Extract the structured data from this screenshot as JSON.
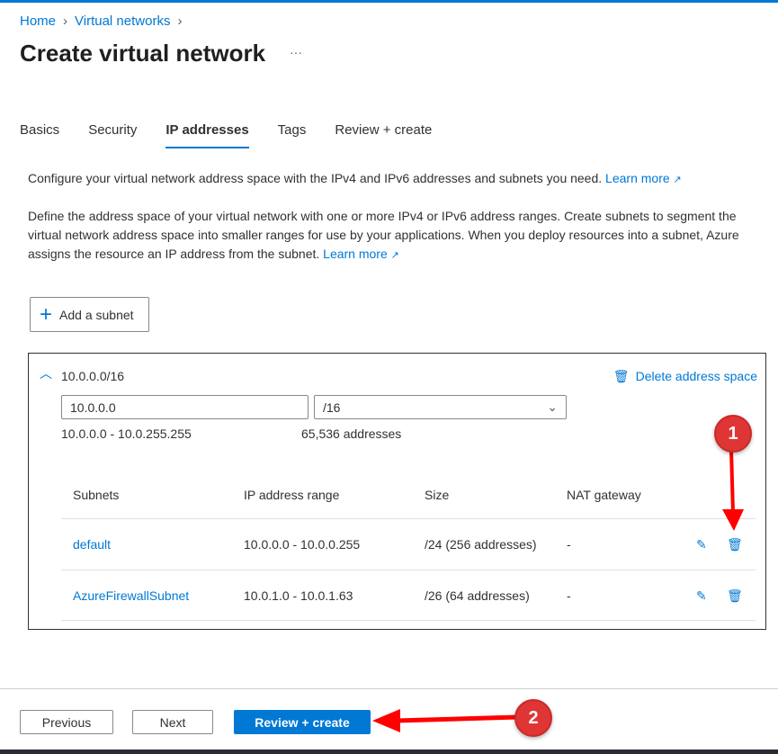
{
  "breadcrumb": [
    "Home",
    "Virtual networks"
  ],
  "title": "Create virtual network",
  "more": "···",
  "tabs": [
    "Basics",
    "Security",
    "IP addresses",
    "Tags",
    "Review + create"
  ],
  "intro": "Configure your virtual network address space with the IPv4 and IPv6 addresses and subnets you need.",
  "intro_link": "Learn more",
  "desc": "Define the address space of your virtual network with one or more IPv4 or IPv6 address ranges. Create subnets to segment the virtual network address space into smaller ranges for use by your applications. When you deploy resources into a subnet, Azure assigns the resource an IP address from the subnet.",
  "desc_link": "Learn more",
  "add_subnet": "Add a subnet",
  "address_space": {
    "title": "10.0.0.0/16",
    "delete": "Delete address space",
    "ip": "10.0.0.0",
    "prefix": "/16",
    "range": "10.0.0.0 - 10.0.255.255",
    "count": "65,536 addresses"
  },
  "table": {
    "headers": [
      "Subnets",
      "IP address range",
      "Size",
      "NAT gateway"
    ],
    "rows": [
      [
        "default",
        "10.0.0.0 - 10.0.0.255",
        "/24 (256 addresses)",
        "-"
      ],
      [
        "AzureFirewallSubnet",
        "10.0.1.0 - 10.0.1.63",
        "/26 (64 addresses)",
        "-"
      ]
    ]
  },
  "footer": {
    "previous": "Previous",
    "next": "Next",
    "review": "Review + create"
  },
  "annotations": [
    "1",
    "2"
  ]
}
